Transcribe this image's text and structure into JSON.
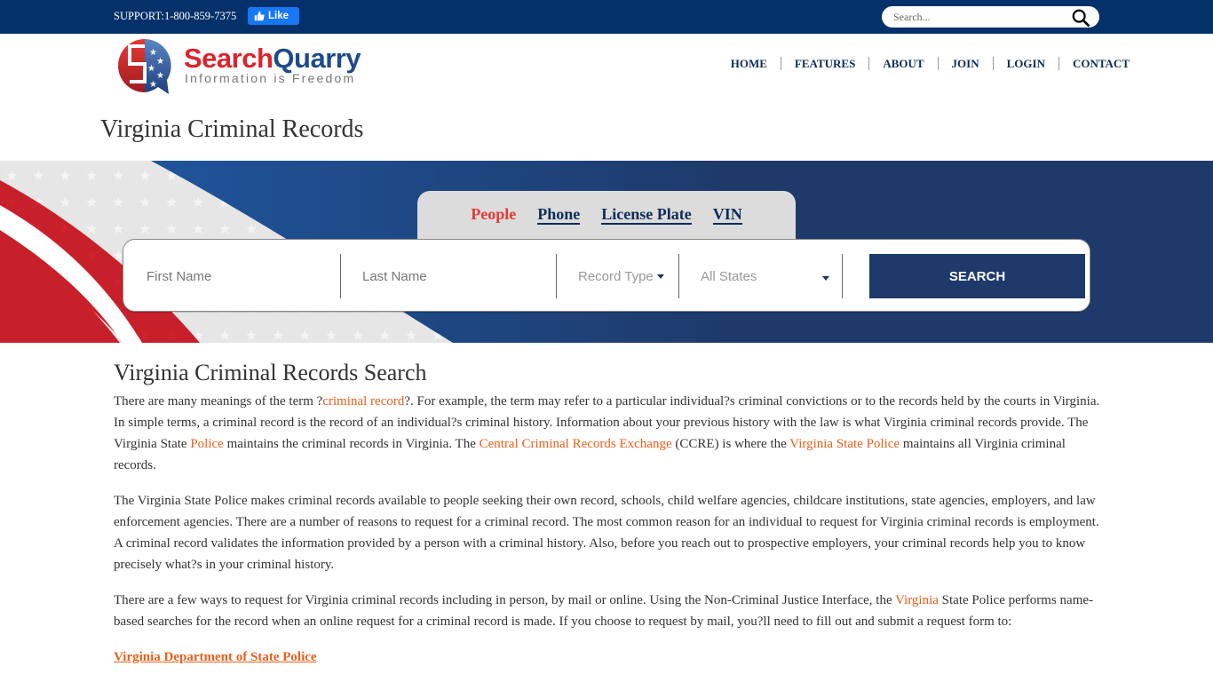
{
  "topbar": {
    "support": "SUPPORT:1-800-859-7375",
    "like_label": "Like",
    "search_placeholder": "Search..."
  },
  "logo": {
    "name_part1": "Search",
    "name_part2": "Quarry",
    "tagline": "Information is Freedom"
  },
  "nav": {
    "items": [
      {
        "label": "HOME"
      },
      {
        "label": "FEATURES"
      },
      {
        "label": "ABOUT"
      },
      {
        "label": "JOIN"
      },
      {
        "label": "LOGIN"
      },
      {
        "label": "CONTACT"
      }
    ]
  },
  "page": {
    "title": "Virginia Criminal Records"
  },
  "search": {
    "tabs": [
      {
        "label": "People",
        "active": true
      },
      {
        "label": "Phone",
        "active": false
      },
      {
        "label": "License Plate",
        "active": false
      },
      {
        "label": "VIN",
        "active": false
      }
    ],
    "first_name_placeholder": "First Name",
    "last_name_placeholder": "Last Name",
    "record_type_label": "Record Type",
    "state_label": "All States",
    "button_label": "SEARCH"
  },
  "colors": {
    "topbar": "#04316a",
    "navy": "#1e3a6b",
    "active_tab": "#e53935",
    "link": "#e8601c"
  },
  "article": {
    "heading": "Virginia Criminal Records Search",
    "p1": {
      "t1": "There are many meanings of the term ?",
      "l1": "criminal record",
      "t2": "?. For example, the term may refer to a particular individual?s criminal convictions or to the records held by the courts in Virginia. In simple terms, a criminal record is the record of an individual?s criminal history. Information about your previous history with the law is what Virginia criminal records provide. The Virginia State ",
      "l2": "Police",
      "t3": " maintains the criminal records in Virginia. The ",
      "l3": "Central Criminal Records Exchange",
      "t4": " (CCRE) is where the ",
      "l4": "Virginia State Police",
      "t5": " maintains all Virginia criminal records."
    },
    "p2": "The Virginia State Police makes criminal records available to people seeking their own record, schools, child welfare agencies, childcare institutions, state agencies, employers, and law enforcement agencies. There are a number of reasons to request for a criminal record. The most common reason for an individual to request for Virginia criminal records is employment. A criminal record validates the information provided by a person with a criminal history. Also, before you reach out to prospective employers, your criminal records help you to know precisely what?s in your criminal history.",
    "p3": {
      "t1": "There are a few ways to request for Virginia criminal records including in person, by mail or online. Using the Non-Criminal Justice Interface, the ",
      "l1": "Virginia",
      "t2": " State Police performs name-based searches for the record when an online request for a criminal record is made. If you choose to request by mail, you?ll need to fill out and submit a request form to:"
    },
    "address_title": "Virginia Department of State Police"
  }
}
